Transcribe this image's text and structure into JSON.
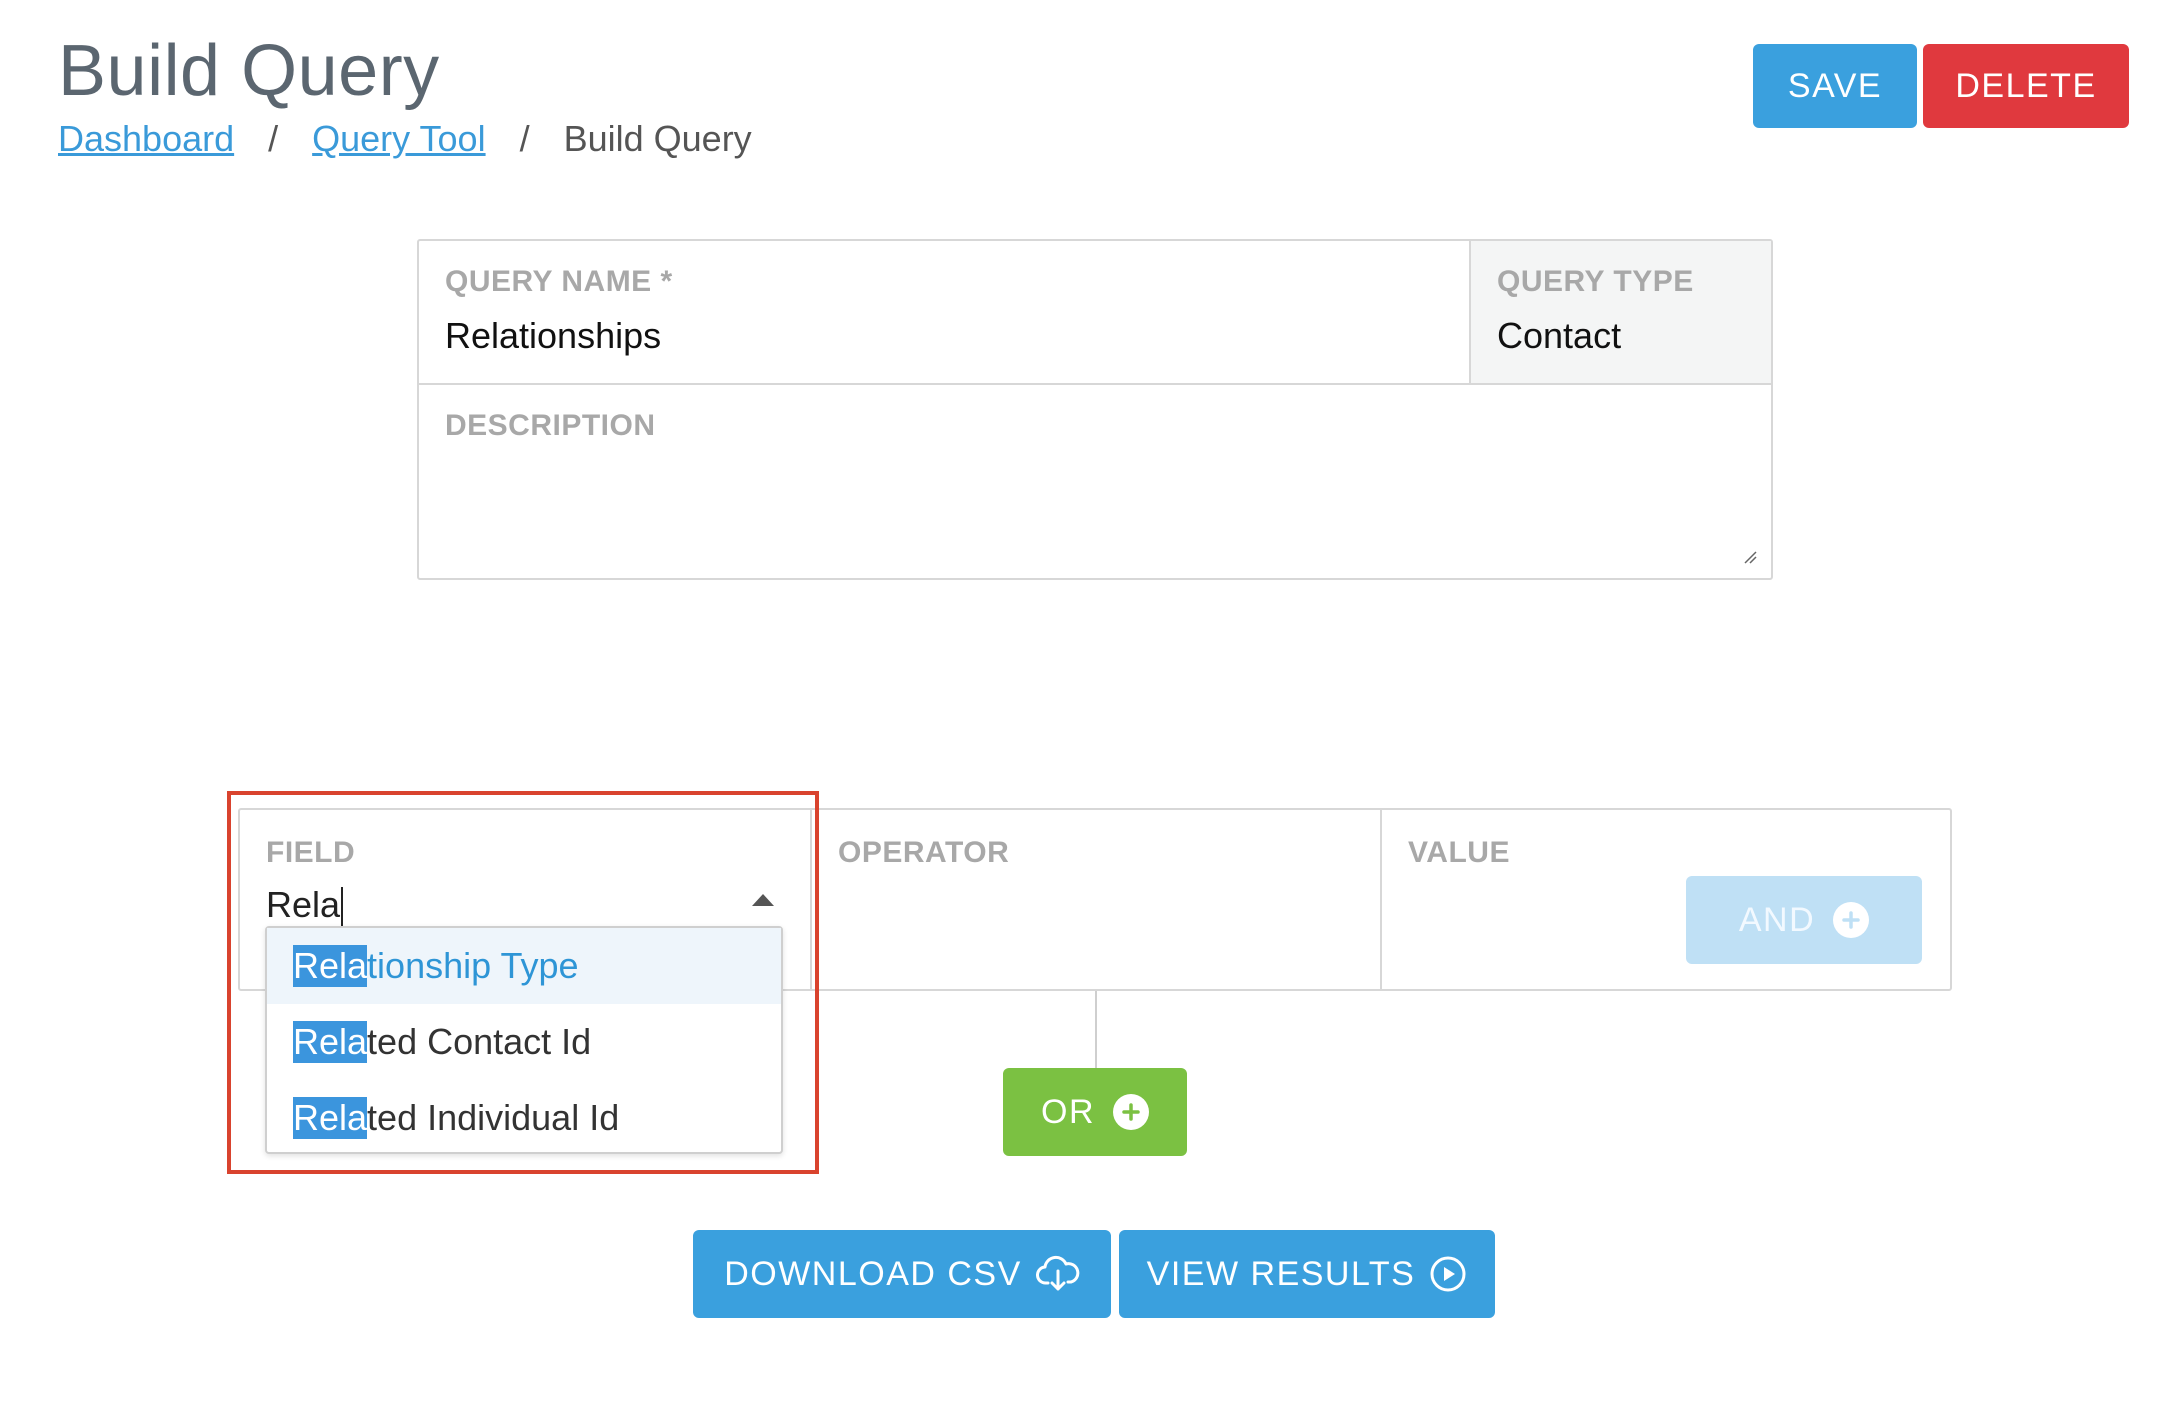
{
  "header": {
    "title": "Build Query",
    "breadcrumb": [
      {
        "label": "Dashboard"
      },
      {
        "label": "Query Tool"
      },
      {
        "label": "Build Query"
      }
    ],
    "separator": "/",
    "save_label": "SAVE",
    "delete_label": "DELETE"
  },
  "query": {
    "name_label": "QUERY NAME *",
    "name_value": "Relationships",
    "type_label": "QUERY TYPE",
    "type_value": "Contact",
    "description_label": "DESCRIPTION",
    "description_value": ""
  },
  "rule": {
    "field_label": "FIELD",
    "field_input": "Rela",
    "operator_label": "OPERATOR",
    "value_label": "VALUE",
    "and_label": "AND",
    "or_label": "OR"
  },
  "dropdown": {
    "match": "Rela",
    "options": [
      {
        "match": "Rela",
        "rest": "tionship Type",
        "active": true
      },
      {
        "match": "Rela",
        "rest": "ted Contact Id",
        "active": false
      },
      {
        "match": "Rela",
        "rest": "ted Individual Id",
        "active": false
      }
    ]
  },
  "actions": {
    "download_label": "DOWNLOAD CSV",
    "view_label": "VIEW RESULTS"
  },
  "icons": {
    "plus": "plus-circle-icon",
    "download": "cloud-download-icon",
    "view": "play-circle-icon",
    "dropdown": "caret-up-icon"
  },
  "colors": {
    "primary": "#3aa0de",
    "danger": "#e0393e",
    "success": "#7bc142",
    "and_disabled": "#bfe0f5",
    "highlight_border": "#d9432e",
    "match_highlight": "#3b95dd"
  }
}
